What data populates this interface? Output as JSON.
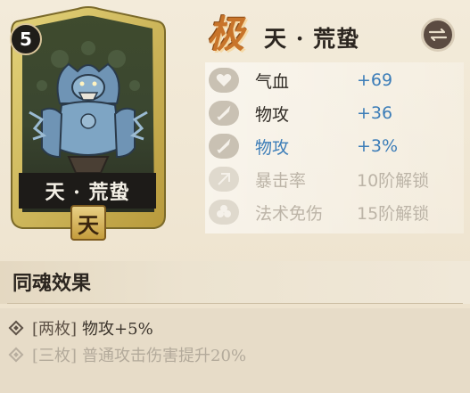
{
  "card": {
    "level": "5",
    "name": "天 · 荒蛰",
    "rarity": "天"
  },
  "header": {
    "grade": "极",
    "title": "天 · 荒蛰",
    "switch_icon": "swap-icon"
  },
  "stats": [
    {
      "icon": "heart-icon",
      "label": "气血",
      "value": "+69",
      "state": "active"
    },
    {
      "icon": "sword-icon",
      "label": "物攻",
      "value": "+36",
      "state": "active"
    },
    {
      "icon": "sword-icon",
      "label": "物攻",
      "value": "+3%",
      "state": "highlight"
    },
    {
      "icon": "crit-icon",
      "label": "暴击率",
      "value": "10阶解锁",
      "state": "locked"
    },
    {
      "icon": "shield-icon",
      "label": "法术免伤",
      "value": "15阶解锁",
      "state": "locked"
    }
  ],
  "set_effect": {
    "title": "同魂效果",
    "effects": [
      {
        "tag": "[两枚]",
        "text": "物攻+5%",
        "active": true
      },
      {
        "tag": "[三枚]",
        "text": "普通攻击伤害提升20%",
        "active": false
      }
    ]
  },
  "colors": {
    "accent_blue": "#3c7db8",
    "grade_orange": "#c8742a",
    "locked_gray": "#bcb4a7"
  }
}
